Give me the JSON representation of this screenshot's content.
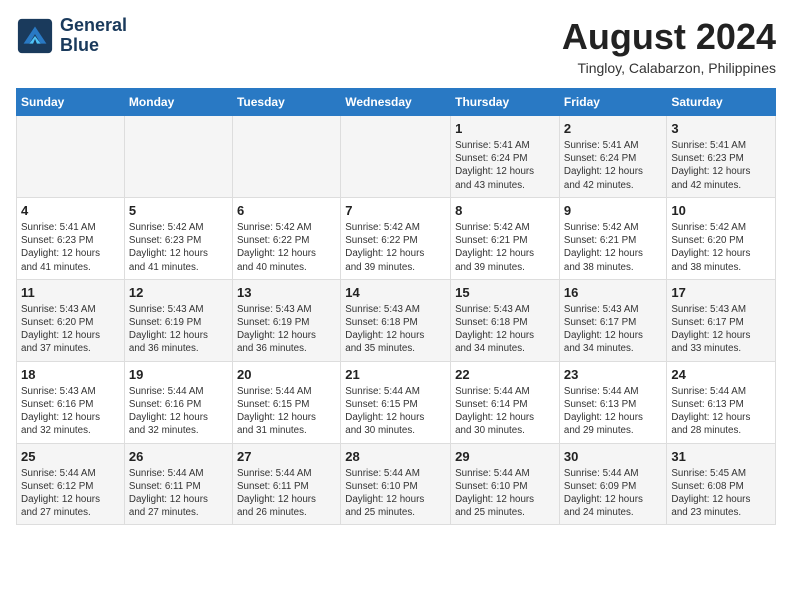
{
  "header": {
    "logo_line1": "General",
    "logo_line2": "Blue",
    "month_year": "August 2024",
    "location": "Tingloy, Calabarzon, Philippines"
  },
  "days_of_week": [
    "Sunday",
    "Monday",
    "Tuesday",
    "Wednesday",
    "Thursday",
    "Friday",
    "Saturday"
  ],
  "weeks": [
    [
      {
        "day": "",
        "text": ""
      },
      {
        "day": "",
        "text": ""
      },
      {
        "day": "",
        "text": ""
      },
      {
        "day": "",
        "text": ""
      },
      {
        "day": "1",
        "text": "Sunrise: 5:41 AM\nSunset: 6:24 PM\nDaylight: 12 hours\nand 43 minutes."
      },
      {
        "day": "2",
        "text": "Sunrise: 5:41 AM\nSunset: 6:24 PM\nDaylight: 12 hours\nand 42 minutes."
      },
      {
        "day": "3",
        "text": "Sunrise: 5:41 AM\nSunset: 6:23 PM\nDaylight: 12 hours\nand 42 minutes."
      }
    ],
    [
      {
        "day": "4",
        "text": "Sunrise: 5:41 AM\nSunset: 6:23 PM\nDaylight: 12 hours\nand 41 minutes."
      },
      {
        "day": "5",
        "text": "Sunrise: 5:42 AM\nSunset: 6:23 PM\nDaylight: 12 hours\nand 41 minutes."
      },
      {
        "day": "6",
        "text": "Sunrise: 5:42 AM\nSunset: 6:22 PM\nDaylight: 12 hours\nand 40 minutes."
      },
      {
        "day": "7",
        "text": "Sunrise: 5:42 AM\nSunset: 6:22 PM\nDaylight: 12 hours\nand 39 minutes."
      },
      {
        "day": "8",
        "text": "Sunrise: 5:42 AM\nSunset: 6:21 PM\nDaylight: 12 hours\nand 39 minutes."
      },
      {
        "day": "9",
        "text": "Sunrise: 5:42 AM\nSunset: 6:21 PM\nDaylight: 12 hours\nand 38 minutes."
      },
      {
        "day": "10",
        "text": "Sunrise: 5:42 AM\nSunset: 6:20 PM\nDaylight: 12 hours\nand 38 minutes."
      }
    ],
    [
      {
        "day": "11",
        "text": "Sunrise: 5:43 AM\nSunset: 6:20 PM\nDaylight: 12 hours\nand 37 minutes."
      },
      {
        "day": "12",
        "text": "Sunrise: 5:43 AM\nSunset: 6:19 PM\nDaylight: 12 hours\nand 36 minutes."
      },
      {
        "day": "13",
        "text": "Sunrise: 5:43 AM\nSunset: 6:19 PM\nDaylight: 12 hours\nand 36 minutes."
      },
      {
        "day": "14",
        "text": "Sunrise: 5:43 AM\nSunset: 6:18 PM\nDaylight: 12 hours\nand 35 minutes."
      },
      {
        "day": "15",
        "text": "Sunrise: 5:43 AM\nSunset: 6:18 PM\nDaylight: 12 hours\nand 34 minutes."
      },
      {
        "day": "16",
        "text": "Sunrise: 5:43 AM\nSunset: 6:17 PM\nDaylight: 12 hours\nand 34 minutes."
      },
      {
        "day": "17",
        "text": "Sunrise: 5:43 AM\nSunset: 6:17 PM\nDaylight: 12 hours\nand 33 minutes."
      }
    ],
    [
      {
        "day": "18",
        "text": "Sunrise: 5:43 AM\nSunset: 6:16 PM\nDaylight: 12 hours\nand 32 minutes."
      },
      {
        "day": "19",
        "text": "Sunrise: 5:44 AM\nSunset: 6:16 PM\nDaylight: 12 hours\nand 32 minutes."
      },
      {
        "day": "20",
        "text": "Sunrise: 5:44 AM\nSunset: 6:15 PM\nDaylight: 12 hours\nand 31 minutes."
      },
      {
        "day": "21",
        "text": "Sunrise: 5:44 AM\nSunset: 6:15 PM\nDaylight: 12 hours\nand 30 minutes."
      },
      {
        "day": "22",
        "text": "Sunrise: 5:44 AM\nSunset: 6:14 PM\nDaylight: 12 hours\nand 30 minutes."
      },
      {
        "day": "23",
        "text": "Sunrise: 5:44 AM\nSunset: 6:13 PM\nDaylight: 12 hours\nand 29 minutes."
      },
      {
        "day": "24",
        "text": "Sunrise: 5:44 AM\nSunset: 6:13 PM\nDaylight: 12 hours\nand 28 minutes."
      }
    ],
    [
      {
        "day": "25",
        "text": "Sunrise: 5:44 AM\nSunset: 6:12 PM\nDaylight: 12 hours\nand 27 minutes."
      },
      {
        "day": "26",
        "text": "Sunrise: 5:44 AM\nSunset: 6:11 PM\nDaylight: 12 hours\nand 27 minutes."
      },
      {
        "day": "27",
        "text": "Sunrise: 5:44 AM\nSunset: 6:11 PM\nDaylight: 12 hours\nand 26 minutes."
      },
      {
        "day": "28",
        "text": "Sunrise: 5:44 AM\nSunset: 6:10 PM\nDaylight: 12 hours\nand 25 minutes."
      },
      {
        "day": "29",
        "text": "Sunrise: 5:44 AM\nSunset: 6:10 PM\nDaylight: 12 hours\nand 25 minutes."
      },
      {
        "day": "30",
        "text": "Sunrise: 5:44 AM\nSunset: 6:09 PM\nDaylight: 12 hours\nand 24 minutes."
      },
      {
        "day": "31",
        "text": "Sunrise: 5:45 AM\nSunset: 6:08 PM\nDaylight: 12 hours\nand 23 minutes."
      }
    ]
  ]
}
